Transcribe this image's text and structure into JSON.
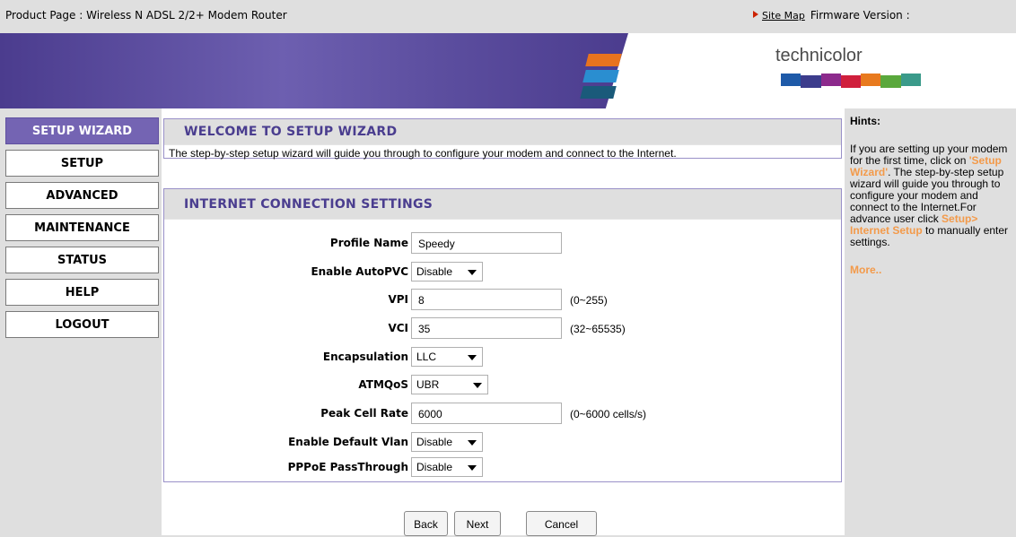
{
  "topbar": {
    "product": "Product Page : Wireless N ADSL 2/2+ Modem Router",
    "site_map": "Site Map",
    "firmware": "Firmware Version :"
  },
  "banner": {
    "brand": "technicolor",
    "brand_bar_colors": [
      "#1e5aa8",
      "#3c3c8c",
      "#8c2a8c",
      "#d01f3c",
      "#e87a1e",
      "#5aa83c",
      "#3a9a8a"
    ]
  },
  "nav": [
    {
      "label": "SETUP WIZARD",
      "active": true
    },
    {
      "label": "SETUP"
    },
    {
      "label": "ADVANCED"
    },
    {
      "label": "MAINTENANCE"
    },
    {
      "label": "STATUS"
    },
    {
      "label": "HELP"
    },
    {
      "label": "LOGOUT"
    }
  ],
  "welcome": {
    "title": "WELCOME TO SETUP WIZARD",
    "description": "The step-by-step setup wizard will guide you through to configure your modem and connect to the Internet."
  },
  "settings": {
    "title": "INTERNET CONNECTION SETTINGS",
    "profile_name": {
      "label": "Profile Name",
      "value": "Speedy"
    },
    "autopvc": {
      "label": "Enable AutoPVC",
      "value": "Disable"
    },
    "vpi": {
      "label": "VPI",
      "value": "8",
      "range": "(0~255)"
    },
    "vci": {
      "label": "VCI",
      "value": "35",
      "range": "(32~65535)"
    },
    "encapsulation": {
      "label": "Encapsulation",
      "value": "LLC"
    },
    "atmqos": {
      "label": "ATMQoS",
      "value": "UBR"
    },
    "peak_cell_rate": {
      "label": "Peak Cell Rate",
      "value": "6000",
      "range": "(0~6000 cells/s)"
    },
    "default_vlan": {
      "label": "Enable Default Vlan",
      "value": "Disable"
    },
    "pppoe": {
      "label": "PPPoE PassThrough",
      "value": "Disable"
    }
  },
  "buttons": {
    "back": "Back",
    "next": "Next",
    "cancel": "Cancel"
  },
  "hints": {
    "title": "Hints:",
    "p1": "If you are setting up your modem for the first time, click on ",
    "p1_link": "'Setup Wizard'",
    "p2": ". The step-by-step setup wizard will guide you through to configure your modem and connect to the Internet.For advance user click ",
    "p2_link": "Setup> Internet Setup",
    "p3": " to manually enter settings.",
    "more": "More.."
  }
}
